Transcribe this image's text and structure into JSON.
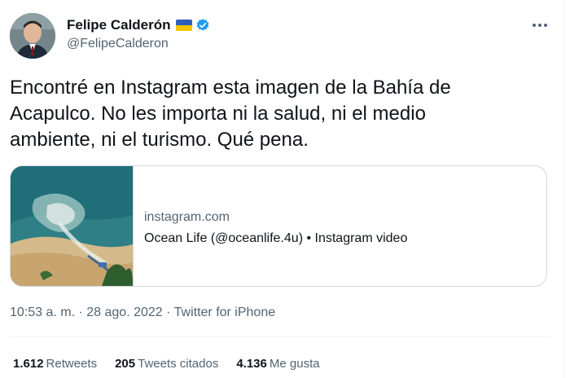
{
  "author": {
    "display_name": "Felipe Calderón",
    "handle": "@FelipeCalderon",
    "flag_colors": [
      "#2e5eb8",
      "#f2c500"
    ],
    "verified_color": "#1d9bf0",
    "avatar": "avatar-photo"
  },
  "tweet": {
    "text": "Encontré en Instagram esta imagen de la Bahía de\nAcapulco. No les importa ni la salud, ni el medio\nambiente, ni el turismo. Qué pena."
  },
  "card": {
    "domain": "instagram.com",
    "title": "Ocean Life (@oceanlife.4u) • Instagram video",
    "thumbnail": "aerial-beach-sewage-photo"
  },
  "meta": {
    "time": "10:53 a. m.",
    "sep1": " · ",
    "date": "28 ago. 2022",
    "sep2": " · ",
    "source": "Twitter for iPhone"
  },
  "stats": {
    "retweets_count": "1.612",
    "retweets_label": "Retweets",
    "quotes_count": "205",
    "quotes_label": "Tweets citados",
    "likes_count": "4.136",
    "likes_label": "Me gusta"
  },
  "icons": {
    "more": "more-horizontal-icon",
    "verified": "verified-badge-icon",
    "flag": "ukraine-flag-icon"
  }
}
